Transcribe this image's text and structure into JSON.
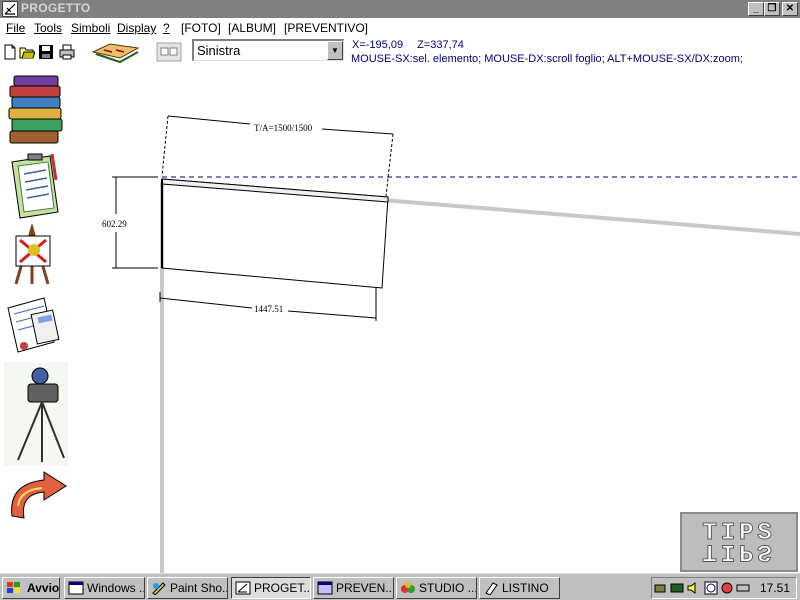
{
  "window": {
    "title": "PROGETTO",
    "minimize": "_",
    "maximize": "❐",
    "close": "✕"
  },
  "menu": {
    "items": [
      {
        "label": "File"
      },
      {
        "label": "Tools"
      },
      {
        "label": "Simboli"
      },
      {
        "label": "Display"
      },
      {
        "label": "?"
      },
      {
        "label": "[FOTO]"
      },
      {
        "label": "[ALBUM]"
      },
      {
        "label": "[PREVENTIVO]"
      }
    ]
  },
  "toolbar": {
    "view_select": {
      "value": "Sinistra"
    },
    "coords": {
      "x": "X=-195,09",
      "z": "Z=337,74"
    },
    "hint": "MOUSE-SX:sel. elemento; MOUSE-DX:scroll foglio; ALT+MOUSE-SX/DX:zoom;"
  },
  "drawing": {
    "label_ta": "T/A=1500/1500",
    "label_height": "602.29",
    "label_width": "1447.51"
  },
  "logo": {
    "text": "TIPS"
  },
  "taskbar": {
    "start": "Avvio",
    "tasks": [
      {
        "label": "Windows ..."
      },
      {
        "label": "Paint Sho..."
      },
      {
        "label": "PROGET..."
      },
      {
        "label": "PREVEN..."
      },
      {
        "label": "STUDIO ..."
      },
      {
        "label": "LISTINO"
      }
    ],
    "clock": "17.51"
  },
  "colors": {
    "title_bg": "#808080",
    "hint_text": "#00007b",
    "taskbar_bg": "#c0c0c0"
  }
}
